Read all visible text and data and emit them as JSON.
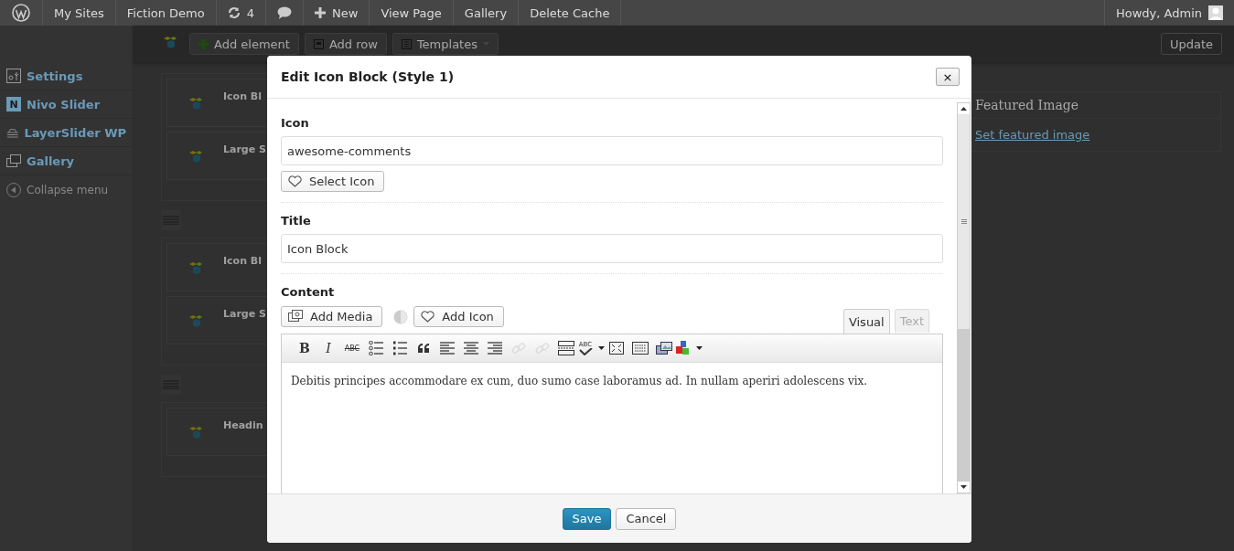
{
  "admin_bar": {
    "items": [
      {
        "kind": "logo"
      },
      {
        "kind": "text",
        "label": "My Sites"
      },
      {
        "kind": "text",
        "label": "Fiction Demo"
      },
      {
        "kind": "updates",
        "label": "4"
      },
      {
        "kind": "comments"
      },
      {
        "kind": "new",
        "label": "New"
      },
      {
        "kind": "text",
        "label": "View Page"
      },
      {
        "kind": "text",
        "label": "Gallery"
      },
      {
        "kind": "text",
        "label": "Delete Cache"
      }
    ],
    "account": "Howdy, Admin"
  },
  "builder_toolbar": {
    "buttons": [
      {
        "kind": "add",
        "label": "Add element"
      },
      {
        "kind": "row",
        "label": "Add row"
      },
      {
        "kind": "templates",
        "label": "Templates"
      }
    ],
    "update_button": "Update"
  },
  "sidebar": {
    "items": [
      {
        "kind": "settings",
        "label": "Settings"
      },
      {
        "kind": "nivo",
        "glyph": "N",
        "label": "Nivo Slider"
      },
      {
        "kind": "layers",
        "label": "LayerSlider WP"
      },
      {
        "kind": "gallery",
        "label": "Gallery"
      }
    ],
    "collapse": "Collapse menu"
  },
  "rows": [
    {
      "elements": [
        "Icon Bl",
        "Large S"
      ]
    },
    {
      "elements": [
        "Icon Bl",
        "Large S"
      ]
    },
    {
      "elements": [
        "Headin"
      ]
    }
  ],
  "featured_image": {
    "title": "Featured Image",
    "link": "Set featured image"
  },
  "modal": {
    "title": "Edit Icon Block (Style 1)",
    "close": "×",
    "icon_label": "Icon",
    "icon_value": "awesome-comments",
    "select_icon": "Select Icon",
    "title_label": "Title",
    "title_value": "Icon Block",
    "content_label": "Content",
    "add_media": "Add Media",
    "add_icon": "Add Icon",
    "tabs": [
      {
        "label": "Visual",
        "selected": true
      },
      {
        "label": "Text",
        "selected": false
      }
    ],
    "toolbar": [
      {
        "kind": "bold",
        "glyph": "B",
        "disabled": false
      },
      {
        "kind": "italic",
        "glyph": "I",
        "disabled": false
      },
      {
        "kind": "strike",
        "glyph": "ABC",
        "disabled": false
      },
      {
        "kind": "bullets",
        "disabled": false
      },
      {
        "kind": "numbers",
        "disabled": false
      },
      {
        "kind": "quote",
        "disabled": false
      },
      {
        "kind": "align-left",
        "disabled": false
      },
      {
        "kind": "align-center",
        "disabled": false
      },
      {
        "kind": "align-right",
        "disabled": false
      },
      {
        "kind": "link",
        "disabled": true
      },
      {
        "kind": "unlink",
        "disabled": true
      },
      {
        "kind": "more",
        "disabled": false
      },
      {
        "kind": "spellcheck",
        "glyph": "ABC",
        "disabled": false
      },
      {
        "kind": "fullscreen",
        "disabled": false
      },
      {
        "kind": "kitchen-sink",
        "disabled": false
      },
      {
        "kind": "media",
        "disabled": false
      },
      {
        "kind": "shortcodes",
        "disabled": false
      }
    ],
    "content": "Debitis principes accommodare ex cum, duo sumo case laboramus ad. In nullam aperiri adolescens vix.",
    "save": "Save",
    "cancel": "Cancel"
  }
}
